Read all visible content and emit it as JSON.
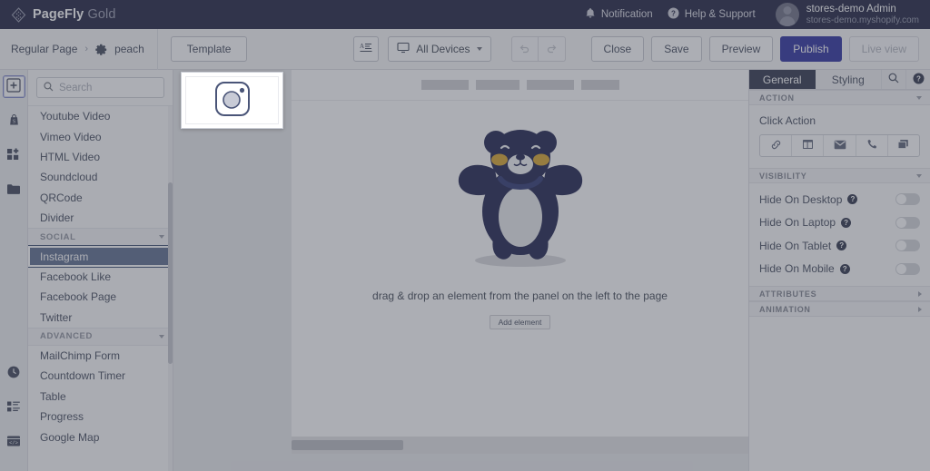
{
  "header": {
    "brand_name": "PageFly",
    "brand_edition": "Gold",
    "notification_label": "Notification",
    "help_label": "Help & Support",
    "user_name": "stores-demo Admin",
    "user_shop": "stores-demo.myshopify.com",
    "bell_icon": "bell-icon",
    "help_icon": "question-circle-icon",
    "logo_icon": "pagefly-diamond-logo"
  },
  "toolbar": {
    "breadcrumb_root": "Regular Page",
    "breadcrumb_sep": "›",
    "breadcrumb_page": "peach",
    "gear_icon": "gear-icon",
    "template_label": "Template",
    "text_align_icon": "text-format-icon",
    "device_icon": "desktop-icon",
    "device_label": "All Devices",
    "undo_icon": "undo-icon",
    "redo_icon": "redo-icon",
    "close_label": "Close",
    "save_label": "Save",
    "preview_label": "Preview",
    "publish_label": "Publish",
    "live_view_label": "Live view",
    "publish_color": "#2a2e9e"
  },
  "rail": {
    "items": [
      {
        "name": "add-element-icon",
        "active": true
      },
      {
        "name": "shopify-bag-icon",
        "active": false
      },
      {
        "name": "elements-grid-icon",
        "active": false
      },
      {
        "name": "folder-icon",
        "active": false
      }
    ],
    "bottom_items": [
      {
        "name": "history-clock-icon"
      },
      {
        "name": "layers-list-icon"
      },
      {
        "name": "code-html-icon"
      }
    ]
  },
  "element_panel": {
    "search_placeholder": "Search",
    "search_value": "",
    "search_icon": "search-icon",
    "items": [
      {
        "type": "item",
        "label": "Youtube Video",
        "selected": false
      },
      {
        "type": "item",
        "label": "Vimeo Video",
        "selected": false
      },
      {
        "type": "item",
        "label": "HTML Video",
        "selected": false
      },
      {
        "type": "item",
        "label": "Soundcloud",
        "selected": false
      },
      {
        "type": "item",
        "label": "QRCode",
        "selected": false
      },
      {
        "type": "item",
        "label": "Divider",
        "selected": false
      },
      {
        "type": "group",
        "label": "SOCIAL",
        "selected": false
      },
      {
        "type": "item",
        "label": "Instagram",
        "selected": true
      },
      {
        "type": "item",
        "label": "Facebook Like",
        "selected": false
      },
      {
        "type": "item",
        "label": "Facebook Page",
        "selected": false
      },
      {
        "type": "item",
        "label": "Twitter",
        "selected": false
      },
      {
        "type": "group",
        "label": "ADVANCED",
        "selected": false
      },
      {
        "type": "item",
        "label": "MailChimp Form",
        "selected": false
      },
      {
        "type": "item",
        "label": "Countdown Timer",
        "selected": false
      },
      {
        "type": "item",
        "label": "Table",
        "selected": false
      },
      {
        "type": "item",
        "label": "Progress",
        "selected": false
      },
      {
        "type": "item",
        "label": "Google Map",
        "selected": false
      }
    ]
  },
  "drag_ghost": {
    "icon": "instagram-camera-icon",
    "element_name": "Instagram"
  },
  "canvas": {
    "nav_placeholders": [
      52,
      48,
      52,
      42
    ],
    "empty_text": "drag & drop an element from the panel on the left to the page",
    "add_element_label": "Add element",
    "mascot_icon": "bear-mascot-illustration",
    "mascot_color": "#1b1f4b",
    "mascot_cheek_color": "#d9a42a"
  },
  "settings_panel": {
    "tab_general": "General",
    "tab_styling": "Styling",
    "search_icon": "search-icon",
    "help_icon": "question-circle-icon",
    "section_action": "ACTION",
    "click_action_label": "Click Action",
    "action_buttons": [
      {
        "name": "link-icon"
      },
      {
        "name": "page-layout-icon"
      },
      {
        "name": "email-icon"
      },
      {
        "name": "phone-icon"
      },
      {
        "name": "popup-copy-icon"
      }
    ],
    "section_visibility": "VISIBILITY",
    "visibility_rows": [
      {
        "label": "Hide On Desktop",
        "on": false
      },
      {
        "label": "Hide On Laptop",
        "on": false
      },
      {
        "label": "Hide On Tablet",
        "on": false
      },
      {
        "label": "Hide On Mobile",
        "on": false
      }
    ],
    "section_attributes": "ATTRIBUTES",
    "section_animation": "ANIMATION"
  }
}
